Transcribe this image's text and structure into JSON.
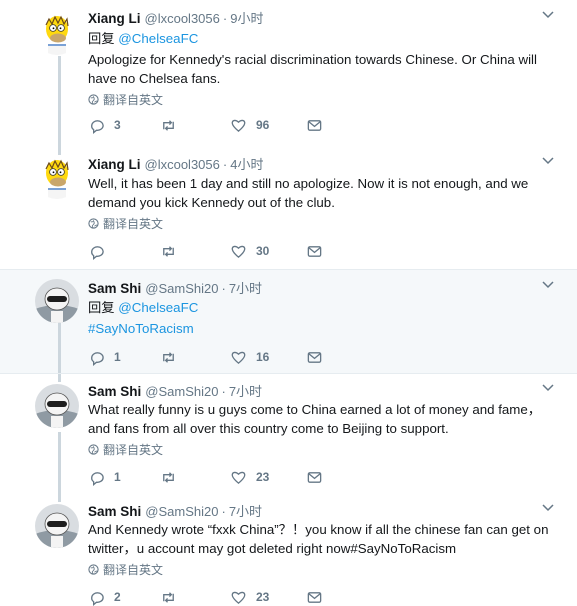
{
  "reply_prefix": "回复",
  "translate_label": "翻译自英文",
  "tweets": [
    {
      "name": "Xiang Li",
      "handle": "@lxcool3056",
      "time": "9小时",
      "reply_to": "@ChelseaFC",
      "text": "Apologize for Kennedy's racial discrimination towards Chinese. Or China will have no Chelsea fans.",
      "replies": "3",
      "retweets": "",
      "likes": "96"
    },
    {
      "name": "Xiang Li",
      "handle": "@lxcool3056",
      "time": "4小时",
      "text": "Well, it has been 1 day and still no apologize. Now it is not enough, and we demand you kick Kennedy out of the club.",
      "replies": "",
      "retweets": "",
      "likes": "30"
    },
    {
      "name": "Sam Shi",
      "handle": "@SamShi20",
      "time": "7小时",
      "reply_to": "@ChelseaFC",
      "hashtag": "#SayNoToRacism",
      "replies": "1",
      "retweets": "",
      "likes": "16"
    },
    {
      "name": "Sam Shi",
      "handle": "@SamShi20",
      "time": "7小时",
      "text": "What really funny is u guys come to China earned a lot of money and fame，and fans from all over this country come to Beijing to support.",
      "replies": "1",
      "retweets": "",
      "likes": "23"
    },
    {
      "name": "Sam Shi",
      "handle": "@SamShi20",
      "time": "7小时",
      "text": "And Kennedy wrote “fxxk China”？！you know if all the chinese fan can get on twitter，u account may got deleted right now#SayNoToRacism",
      "replies": "2",
      "retweets": "",
      "likes": "23"
    }
  ],
  "colors": {
    "link": "#1b95e0",
    "secondary_text": "#657786",
    "highlight_bg": "#f5f8fa",
    "thread_line": "#ccd6dd"
  }
}
